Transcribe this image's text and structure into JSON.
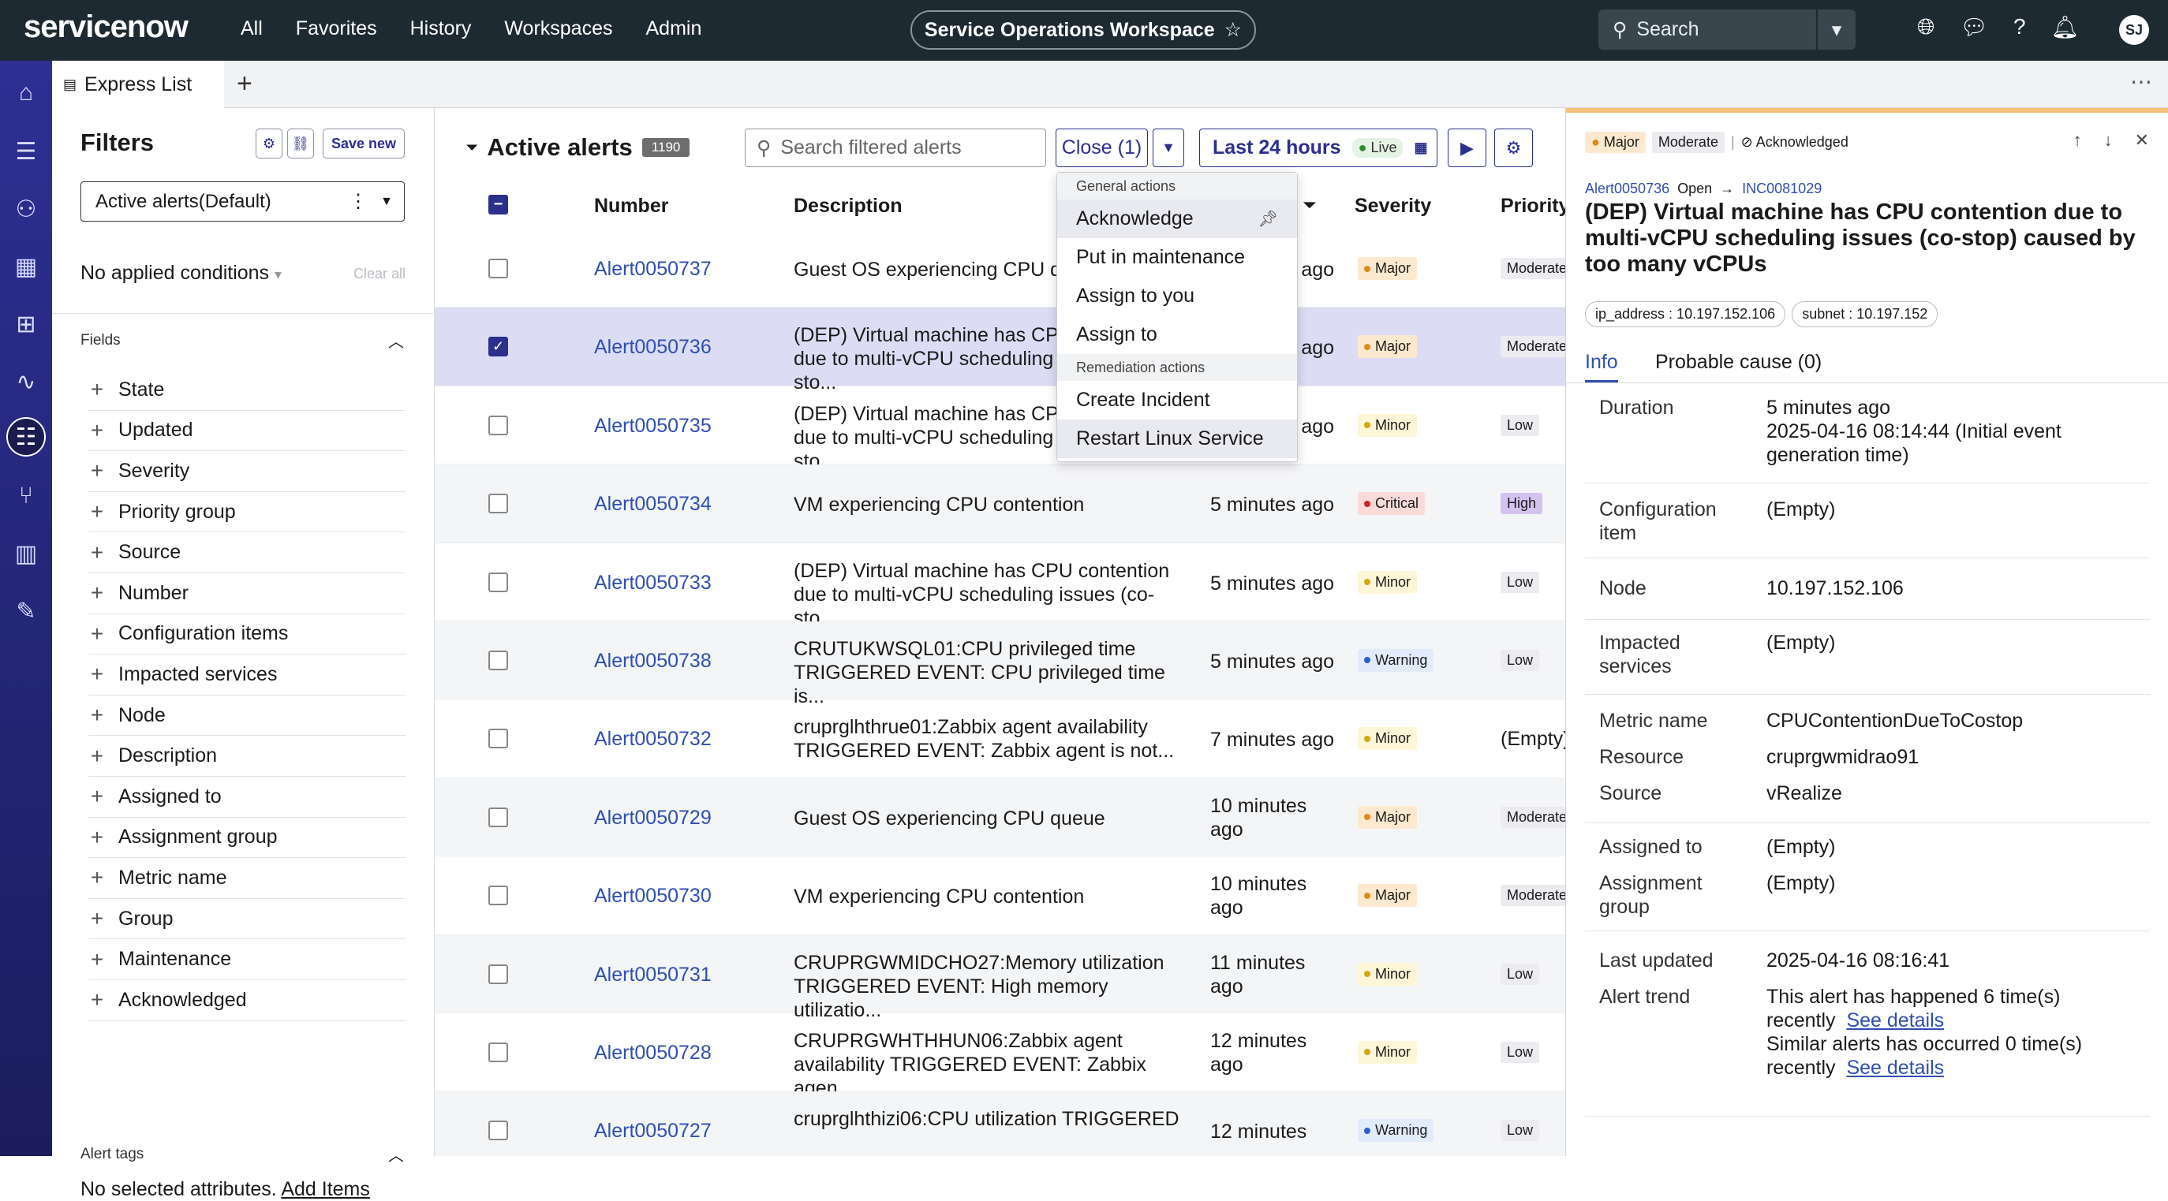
{
  "topbar": {
    "logo": "servicenow",
    "nav": [
      "All",
      "Favorites",
      "History",
      "Workspaces",
      "Admin"
    ],
    "workspace": "Service Operations Workspace",
    "search_placeholder": "Search",
    "avatar": "SJ"
  },
  "tabs": {
    "active": "Express List"
  },
  "filters": {
    "title": "Filters",
    "save_new": "Save new",
    "selected_filter": "Active alerts(Default)",
    "no_applied": "No applied conditions",
    "clear_all": "Clear all",
    "fields_header": "Fields",
    "fields": [
      "State",
      "Updated",
      "Severity",
      "Priority group",
      "Source",
      "Number",
      "Configuration items",
      "Impacted services",
      "Node",
      "Description",
      "Assigned to",
      "Assignment group",
      "Metric name",
      "Group",
      "Maintenance",
      "Acknowledged"
    ],
    "alert_tags_header": "Alert tags",
    "no_selected": "No selected attributes.",
    "add_items": "Add Items"
  },
  "main": {
    "title": "Active alerts",
    "count": "1190",
    "search_placeholder": "Search filtered alerts",
    "close_label": "Close (1)",
    "time_range": "Last 24 hours",
    "live": "Live",
    "columns": {
      "number": "Number",
      "description": "Description",
      "severity": "Severity",
      "priority": "Priority"
    },
    "rows": [
      {
        "number": "Alert0050737",
        "desc": [
          "Guest OS experiencing CPU queue"
        ],
        "updated": "5 minutes ago",
        "severity": "Major",
        "priority": "Moderate"
      },
      {
        "number": "Alert0050736",
        "desc": [
          "(DEP) Virtual machine has CPU contention",
          "due to multi-vCPU scheduling issues (co-sto..."
        ],
        "updated": "5 minutes ago",
        "severity": "Major",
        "priority": "Moderate"
      },
      {
        "number": "Alert0050735",
        "desc": [
          "(DEP) Virtual machine has CPU contention",
          "due to multi-vCPU scheduling issues (co-sto..."
        ],
        "updated": "5 minutes ago",
        "severity": "Minor",
        "priority": "Low"
      },
      {
        "number": "Alert0050734",
        "desc": [
          "VM experiencing CPU contention"
        ],
        "updated": "5 minutes ago",
        "severity": "Critical",
        "priority": "High"
      },
      {
        "number": "Alert0050733",
        "desc": [
          "(DEP) Virtual machine has CPU contention",
          "due to multi-vCPU scheduling issues (co-sto..."
        ],
        "updated": "5 minutes ago",
        "severity": "Minor",
        "priority": "Low"
      },
      {
        "number": "Alert0050738",
        "desc": [
          "CRUTUKWSQL01:CPU privileged time",
          "TRIGGERED EVENT: CPU privileged time is..."
        ],
        "updated": "5 minutes ago",
        "severity": "Warning",
        "priority": "Low"
      },
      {
        "number": "Alert0050732",
        "desc": [
          "cruprglhthrue01:Zabbix agent availability",
          "TRIGGERED EVENT: Zabbix agent is not..."
        ],
        "updated": "7 minutes ago",
        "severity": "Minor",
        "priority": "(Empty)"
      },
      {
        "number": "Alert0050729",
        "desc": [
          "Guest OS experiencing CPU queue"
        ],
        "updated": "10 minutes ago",
        "severity": "Major",
        "priority": "Moderate"
      },
      {
        "number": "Alert0050730",
        "desc": [
          "VM experiencing CPU contention"
        ],
        "updated": "10 minutes ago",
        "severity": "Major",
        "priority": "Moderate"
      },
      {
        "number": "Alert0050731",
        "desc": [
          "CRUPRGWMIDCHO27:Memory utilization",
          "TRIGGERED EVENT: High memory utilizatio..."
        ],
        "updated": "11 minutes ago",
        "severity": "Minor",
        "priority": "Low"
      },
      {
        "number": "Alert0050728",
        "desc": [
          "CRUPRGWHTHHUN06:Zabbix agent",
          "availability TRIGGERED EVENT: Zabbix agen..."
        ],
        "updated": "12 minutes ago",
        "severity": "Minor",
        "priority": "Low"
      },
      {
        "number": "Alert0050727",
        "desc": [
          "cruprglhthizi06:CPU utilization TRIGGERED",
          ""
        ],
        "updated": "12 minutes",
        "severity": "Warning",
        "priority": "Low"
      }
    ]
  },
  "dropdown": {
    "general_header": "General actions",
    "general": [
      "Acknowledge",
      "Put in maintenance",
      "Assign to you",
      "Assign to"
    ],
    "remediation_header": "Remediation actions",
    "remediation": [
      "Create Incident",
      "Restart Linux Service"
    ]
  },
  "colors": {
    "Major": "#fde9cf",
    "Minor": "#fdf6d8",
    "Critical": "#fbdada",
    "Warning": "#e1ebfa",
    "Major_dot": "#e08a1e",
    "Minor_dot": "#d4a514",
    "Critical_dot": "#d1232a",
    "Warning_dot": "#2b5fcb",
    "Moderate": "#ecebf0",
    "Low": "#ecebf0",
    "High": "#d4c2f0"
  },
  "detail": {
    "sev_tag": "Major",
    "pri_tag": "Moderate",
    "ack_tag": "Acknowledged",
    "alert_number": "Alert0050736",
    "state": "Open",
    "incident": "INC0081029",
    "title": "(DEP) Virtual machine has CPU contention due to multi-vCPU scheduling issues (co-stop) caused by too many vCPUs",
    "chips": [
      "ip_address : 10.197.152.106",
      "subnet : 10.197.152"
    ],
    "tabs": [
      "Info",
      "Probable cause (0)"
    ],
    "duration_label": "Duration",
    "duration": [
      "5 minutes ago",
      "2025-04-16 08:14:44 (Initial event",
      "generation time)"
    ],
    "ci_label": [
      "Configuration",
      "item"
    ],
    "ci": "(Empty)",
    "node_label": "Node",
    "node": "10.197.152.106",
    "impacted_label": [
      "Impacted",
      "services"
    ],
    "impacted": "(Empty)",
    "metric_label": "Metric name",
    "metric": "CPUContentionDueToCostop",
    "resource_label": "Resource",
    "resource": "cruprgwmidrao91",
    "source_label": "Source",
    "source": "vRealize",
    "assigned_label": "Assigned to",
    "assigned": "(Empty)",
    "group_label": [
      "Assignment",
      "group"
    ],
    "group": "(Empty)",
    "updated_label": "Last updated",
    "updated": "2025-04-16 08:16:41",
    "trend_label": "Alert trend",
    "trend1a": "This alert has happened 6 time(s)",
    "trend1b": "recently",
    "trend2a": "Similar alerts has occurred 0 time(s)",
    "trend2b": "recently",
    "see_details": "See details"
  }
}
